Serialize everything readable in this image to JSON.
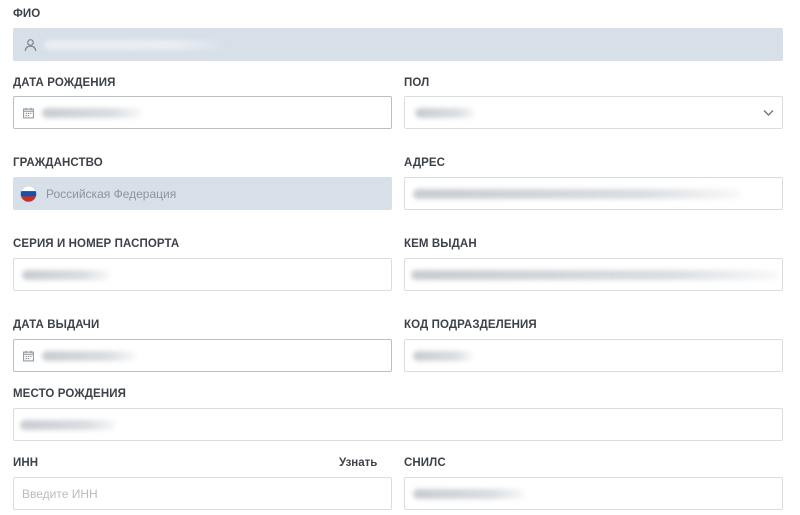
{
  "form": {
    "fio": {
      "label": "ФИО",
      "icon": "user-icon"
    },
    "birth_date": {
      "label": "ДАТА РОЖДЕНИЯ",
      "icon": "calendar-icon"
    },
    "gender": {
      "label": "ПОЛ",
      "icon": "chevron-down-icon"
    },
    "citizenship": {
      "label": "ГРАЖДАНСТВО",
      "value": "Российская Федерация",
      "icon": "russia-flag-icon"
    },
    "address": {
      "label": "АДРЕС"
    },
    "passport": {
      "label": "СЕРИЯ И НОМЕР ПАСПОРТА"
    },
    "issued_by": {
      "label": "КЕМ ВЫДАН"
    },
    "issue_date": {
      "label": "ДАТА ВЫДАЧИ",
      "icon": "calendar-icon"
    },
    "division_code": {
      "label": "КОД ПОДРАЗДЕЛЕНИЯ"
    },
    "birth_place": {
      "label": "МЕСТО РОЖДЕНИЯ"
    },
    "inn": {
      "label": "ИНН",
      "link": "Узнать",
      "placeholder": "Введите ИНН"
    },
    "snils": {
      "label": "СНИЛС"
    }
  },
  "colors": {
    "readonly_bg": "#d7dfe8",
    "border": "#d9dde2",
    "label": "#3d4249"
  }
}
